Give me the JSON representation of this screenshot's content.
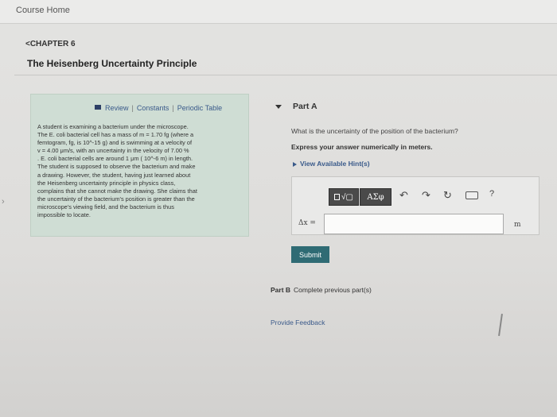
{
  "nav": {
    "course_home": "Course Home",
    "chapter": "<CHAPTER 6"
  },
  "page_title": "The Heisenberg Uncertainty Principle",
  "links": {
    "review": "Review",
    "constants": "Constants",
    "periodic_table": "Periodic Table",
    "separator": "|"
  },
  "problem_lines": [
    "A student is examining a bacterium under the microscope.",
    "The E. coli bacterial cell has a mass of m = 1.70 fg (where a",
    "femtogram, fg, is 10^-15 g) and is swimming at a velocity of",
    "v = 4.00 μm/s, with an uncertainty in the velocity of 7.00 %",
    ". E. coli bacterial cells are around 1 μm ( 10^-6 m) in length.",
    "The student is supposed to observe the bacterium and make",
    "a drawing. However, the student, having just learned about",
    "the Heisenberg uncertainty principle in physics class,",
    "complains that she cannot make the drawing. She claims that",
    "the uncertainty of the bacterium's position is greater than the",
    "microscope's viewing field, and the bacterium is thus",
    "impossible to locate."
  ],
  "part_a": {
    "label": "Part A",
    "question": "What is the uncertainty of the position of the bacterium?",
    "instruction": "Express your answer numerically in meters.",
    "hint_link": "View Available Hint(s)",
    "toolbar": {
      "radical": "√▢",
      "greek": "ΑΣφ",
      "undo": "↶",
      "redo": "↷",
      "reset": "↻",
      "help": "?"
    },
    "answer_label": "Δx =",
    "answer_value": "",
    "unit": "m",
    "submit": "Submit"
  },
  "part_b": {
    "label": "Part B",
    "status": "Complete previous part(s)"
  },
  "feedback": "Provide Feedback",
  "chevron": "›",
  "colors": {
    "panel_bg": "#cfddd4",
    "submit_bg": "#2f6b74",
    "link": "#3a5a8a",
    "tool_bg": "#4a4a4a"
  }
}
